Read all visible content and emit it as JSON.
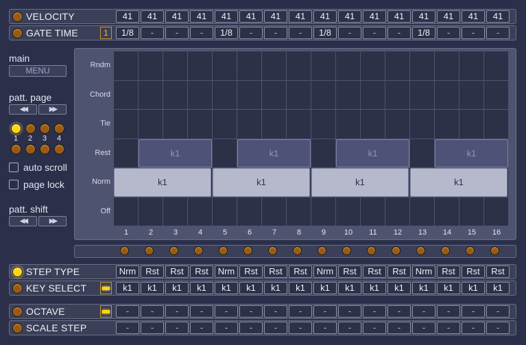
{
  "velocity": {
    "label": "VELOCITY",
    "values": [
      "41",
      "41",
      "41",
      "41",
      "41",
      "41",
      "41",
      "41",
      "41",
      "41",
      "41",
      "41",
      "41",
      "41",
      "41",
      "41"
    ]
  },
  "gate_time": {
    "label": "GATE TIME",
    "box": "1",
    "values": [
      "1/8",
      "-",
      "-",
      "-",
      "1/8",
      "-",
      "-",
      "-",
      "1/8",
      "-",
      "-",
      "-",
      "1/8",
      "-",
      "-",
      "-"
    ]
  },
  "side": {
    "main_label": "main",
    "menu_button": "MENU",
    "patt_page_label": "patt. page",
    "left_arrows": "◀◀",
    "right_arrows": "▶▶",
    "page_numbers": [
      "1",
      "2",
      "3",
      "4"
    ],
    "auto_scroll": "auto scroll",
    "page_lock": "page lock",
    "patt_shift_label": "patt. shift"
  },
  "grid": {
    "rows": [
      "Rndm",
      "Chord",
      "Tie",
      "Rest",
      "Norm",
      "Off"
    ],
    "columns": [
      "1",
      "2",
      "3",
      "4",
      "5",
      "6",
      "7",
      "8",
      "9",
      "10",
      "11",
      "12",
      "13",
      "14",
      "15",
      "16"
    ],
    "norm_blocks": [
      "k1",
      "k1",
      "k1",
      "k1"
    ],
    "rest_blocks": [
      "k1",
      "k1",
      "k1",
      "k1"
    ]
  },
  "step_type": {
    "label": "STEP TYPE",
    "values": [
      "Nrm",
      "Rst",
      "Rst",
      "Rst",
      "Nrm",
      "Rst",
      "Rst",
      "Rst",
      "Nrm",
      "Rst",
      "Rst",
      "Rst",
      "Nrm",
      "Rst",
      "Rst",
      "Rst"
    ]
  },
  "key_select": {
    "label": "KEY SELECT",
    "values": [
      "k1",
      "k1",
      "k1",
      "k1",
      "k1",
      "k1",
      "k1",
      "k1",
      "k1",
      "k1",
      "k1",
      "k1",
      "k1",
      "k1",
      "k1",
      "k1"
    ]
  },
  "octave": {
    "label": "OCTAVE",
    "values": [
      "-",
      "-",
      "-",
      "-",
      "-",
      "-",
      "-",
      "-",
      "-",
      "-",
      "-",
      "-",
      "-",
      "-",
      "-",
      "-"
    ]
  },
  "scale_step": {
    "label": "SCALE STEP",
    "values": [
      "-",
      "-",
      "-",
      "-",
      "-",
      "-",
      "-",
      "-",
      "-",
      "-",
      "-",
      "-",
      "-",
      "-",
      "-",
      "-"
    ]
  },
  "colors": {
    "background": "#2b2f4a",
    "led_on": "#ffd60a",
    "led_off": "#9a5a10",
    "norm_block": "#b6b9cc",
    "rest_block": "#4d5276"
  }
}
